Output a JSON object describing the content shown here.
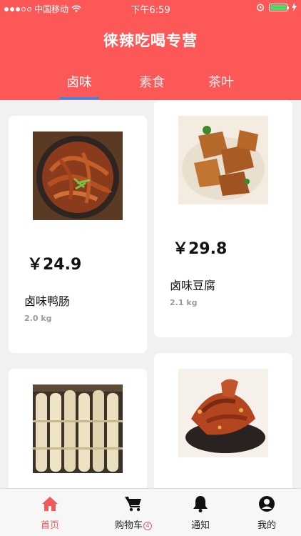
{
  "status_bar": {
    "carrier": "中国移动",
    "time": "下午6:59"
  },
  "header": {
    "title": "徕辣吃喝专营"
  },
  "tabs": [
    {
      "label": "卤味",
      "active": true
    },
    {
      "label": "素食",
      "active": false
    },
    {
      "label": "茶叶",
      "active": false
    }
  ],
  "products": [
    {
      "price": "￥24.9",
      "name": "卤味鸭肠",
      "weight": "2.0 kg",
      "image": "braised-duck-intestine-photo"
    },
    {
      "price": "￥29.8",
      "name": "卤味豆腐",
      "weight": "2.1 kg",
      "image": "braised-tofu-photo"
    },
    {
      "price": "",
      "name": "",
      "weight": "",
      "image": "bamboo-shoots-photo"
    },
    {
      "price": "",
      "name": "",
      "weight": "",
      "image": "spicy-duck-photo"
    }
  ],
  "tabbar": {
    "items": [
      {
        "label": "首页",
        "icon": "home-icon",
        "active": true
      },
      {
        "label": "购物车",
        "icon": "cart-icon",
        "badge": "4"
      },
      {
        "label": "通知",
        "icon": "bell-icon"
      },
      {
        "label": "我的",
        "icon": "user-icon"
      }
    ]
  },
  "colors": {
    "brand_red": "#fc5857",
    "tab_indicator": "#1e90ff",
    "active_tab_red": "#f15a5a"
  }
}
